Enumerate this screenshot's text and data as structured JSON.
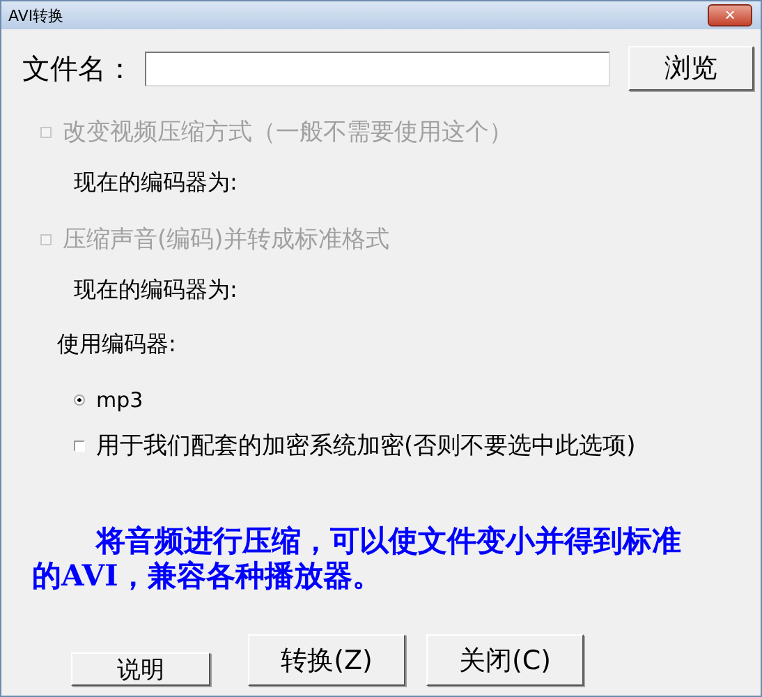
{
  "window": {
    "title": "AVI转换",
    "close_button": "×"
  },
  "file": {
    "label": "文件名：",
    "browse_button": "浏览"
  },
  "rows": [
    {
      "kind": "checkbox",
      "label": "改变视频压缩方式（一般不需要使用这个）",
      "checked": false,
      "disabled": true
    },
    {
      "kind": "info",
      "label": "现在的编码器为:"
    },
    {
      "kind": "checkbox",
      "label": "压缩声音(编码)并转成标准格式",
      "checked": false,
      "disabled": true
    },
    {
      "kind": "info",
      "label": "现在的编码器为:"
    },
    {
      "kind": "heading",
      "label": "使用编码器:"
    },
    {
      "kind": "radio",
      "label": "mp3",
      "selected": true
    },
    {
      "kind": "checkbox",
      "label": "用于我们配套的加密系统加密(否则不要选中此选项)",
      "checked": false,
      "disabled": false
    }
  ],
  "note": "将音频进行压缩，可以使文件变小并得到标准的AVI，兼容各种播放器。",
  "buttons": [
    {
      "kind": "small",
      "label": "说明"
    },
    {
      "kind": "large",
      "label": "转换(Z)"
    },
    {
      "kind": "large",
      "label": "关闭(C)"
    }
  ]
}
